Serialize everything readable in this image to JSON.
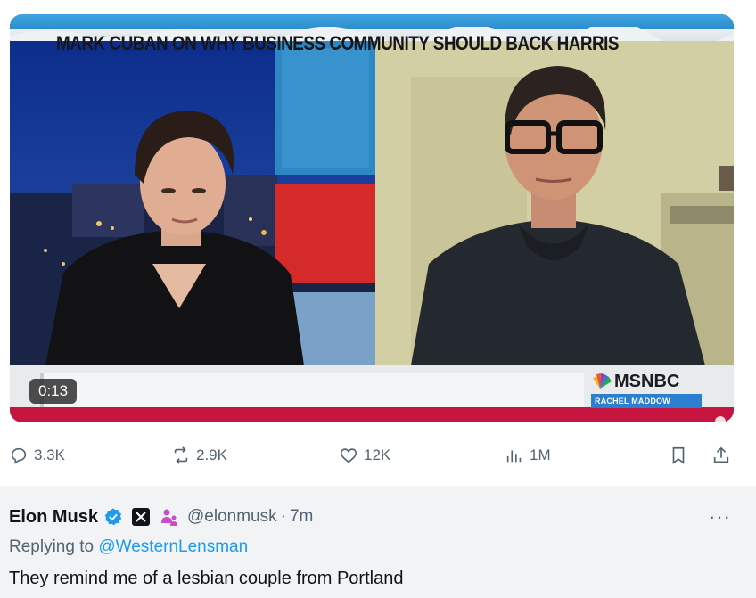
{
  "video": {
    "headline": "MARK CUBAN ON WHY BUSINESS COMMUNITY SHOULD BACK HARRIS",
    "network_logo": "MSNBC",
    "show_label": "RACHEL MADDOW",
    "timestamp": "0:13"
  },
  "actions": {
    "replies": "3.3K",
    "reposts": "2.9K",
    "likes": "12K",
    "views": "1M",
    "icons": [
      "reply-icon",
      "repost-icon",
      "like-icon",
      "views-icon",
      "bookmark-icon",
      "share-icon"
    ]
  },
  "reply": {
    "author_name": "Elon Musk",
    "handle": "@elonmusk",
    "separator": "·",
    "time_ago": "7m",
    "more_label": "···",
    "replying_prefix": "Replying to",
    "replying_to": "@WesternLensman",
    "text": "They remind me of a lesbian couple from Portland"
  },
  "colors": {
    "accent_blue": "#1d9bf0",
    "muted_text": "#536471",
    "lower_third_red": "#c6163f",
    "msnbc_blue": "#2a7fd0"
  }
}
